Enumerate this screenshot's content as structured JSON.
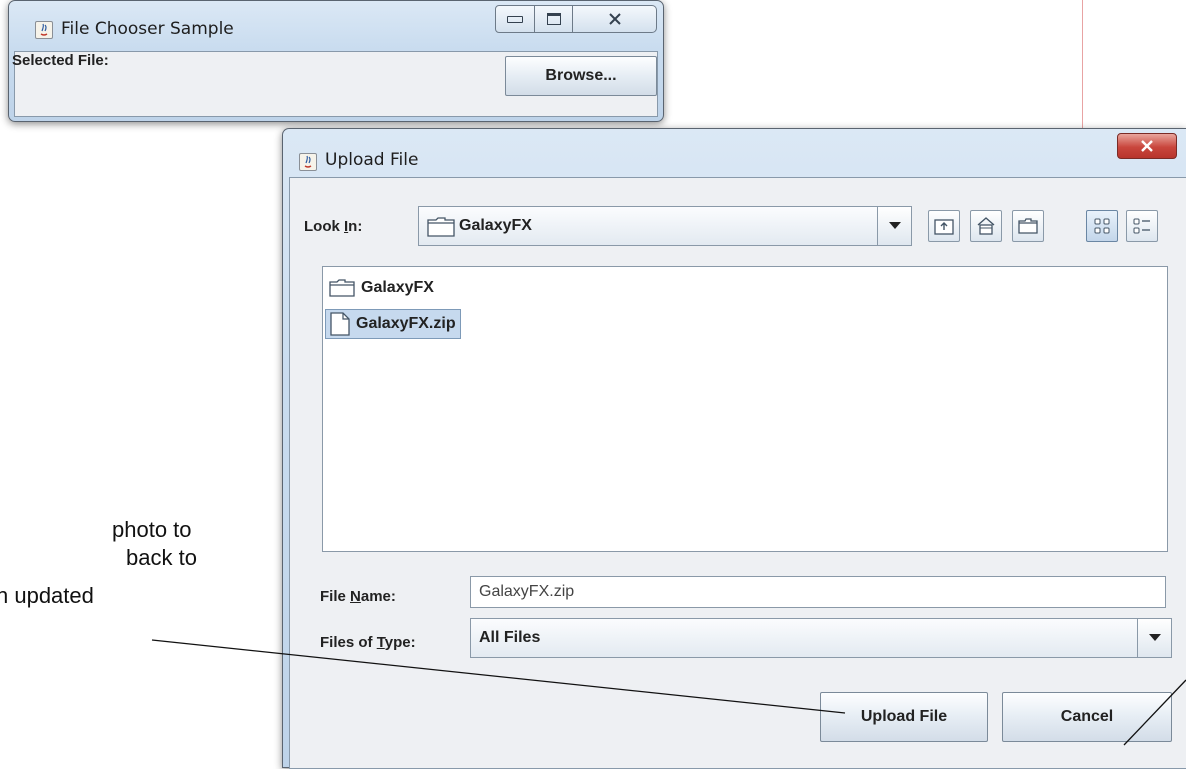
{
  "main_window": {
    "title": "File Chooser Sample",
    "selected_file_label": "Selected File:",
    "browse_label": "Browse..."
  },
  "dialog": {
    "title": "Upload File",
    "look_in_label_pre": "Look ",
    "look_in_label_key": "I",
    "look_in_label_post": "n:",
    "look_in_value": "GalaxyFX",
    "toolbar": {
      "up_icon": "up-one-level-icon",
      "home_icon": "home-icon",
      "new_folder_icon": "new-folder-icon",
      "list_icon": "list-view-icon",
      "details_icon": "details-view-icon"
    },
    "files": [
      {
        "name": "GalaxyFX",
        "type": "folder",
        "selected": false
      },
      {
        "name": "GalaxyFX.zip",
        "type": "file",
        "selected": true
      }
    ],
    "file_name_label_pre": "File ",
    "file_name_label_key": "N",
    "file_name_label_post": "ame:",
    "file_name_value": "GalaxyFX.zip",
    "files_of_type_label_pre": "Files of ",
    "files_of_type_label_key": "T",
    "files_of_type_label_post": "ype:",
    "files_of_type_value": "All Files",
    "upload_label": "Upload File",
    "cancel_label": "Cancel"
  },
  "annotation": {
    "line1": "photo to",
    "line2": "back to",
    "line3": "n updated"
  },
  "colors": {
    "selection": "#c6d9ee",
    "close_button": "#c9463d",
    "guide_line": "#e8a3a3"
  }
}
